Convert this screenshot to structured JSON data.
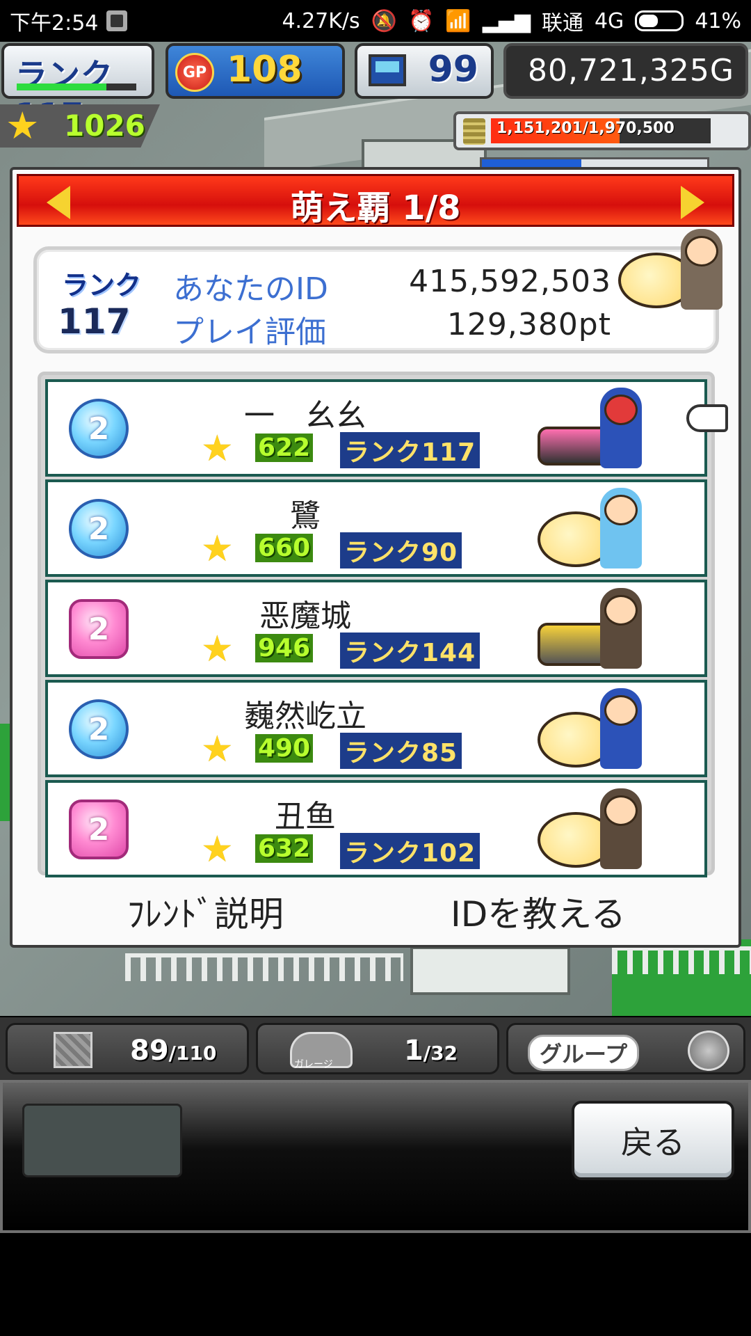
{
  "status_bar": {
    "time": "下午2:54",
    "net_speed": "4.27K/s",
    "carrier": "联通",
    "network": "4G",
    "battery": "41%",
    "battery_level": 0.41,
    "icons": [
      "image-icon",
      "mute-bell-icon",
      "alarm-icon",
      "wifi-icon",
      "signal-icon",
      "battery-icon"
    ]
  },
  "hud": {
    "rank_label": "ランク117",
    "rank_progress": 0.75,
    "gp_icon": "GP",
    "gp_value": "108",
    "pc_value": "99",
    "gold": "80,721,325G",
    "stars": "1026",
    "money_meter_text": "1,151,201/1,970,500",
    "money_progress": 0.584,
    "blue_meter_progress": 0.44
  },
  "dialog": {
    "title": "萌え覇 1/8",
    "my_info": {
      "rank_label": "ランク",
      "rank_value": "117",
      "id_label": "あなたのID",
      "id_value": "415,592,503",
      "score_label": "プレイ評価",
      "score_value": "129,380pt"
    },
    "friends": [
      {
        "badge": "2",
        "badge_color": "blue",
        "name": "一　幺幺",
        "stars": "622",
        "rank": "ランク117",
        "avatar": "kart-racer"
      },
      {
        "badge": "2",
        "badge_color": "blue",
        "name": "鷺",
        "stars": "660",
        "rank": "ランク90",
        "avatar": "chick-rider"
      },
      {
        "badge": "2",
        "badge_color": "pink",
        "name": "恶魔城",
        "stars": "946",
        "rank": "ランク144",
        "avatar": "kart-pirate"
      },
      {
        "badge": "2",
        "badge_color": "blue",
        "name": "巍然屹立",
        "stars": "490",
        "rank": "ランク85",
        "avatar": "chick-rider"
      },
      {
        "badge": "2",
        "badge_color": "pink",
        "name": "丑鱼",
        "stars": "632",
        "rank": "ランク102",
        "avatar": "chick-pirate"
      }
    ],
    "friend_help_button": "ﾌﾚﾝﾄﾞ説明",
    "share_id_button": "IDを教える"
  },
  "bottom_hud": {
    "items_count": "89",
    "items_max": "/110",
    "garage_label": "ガレージ",
    "garage_count": "1",
    "garage_max": "/32",
    "group_label": "グループ"
  },
  "commands": {
    "back_button": "戻る"
  }
}
